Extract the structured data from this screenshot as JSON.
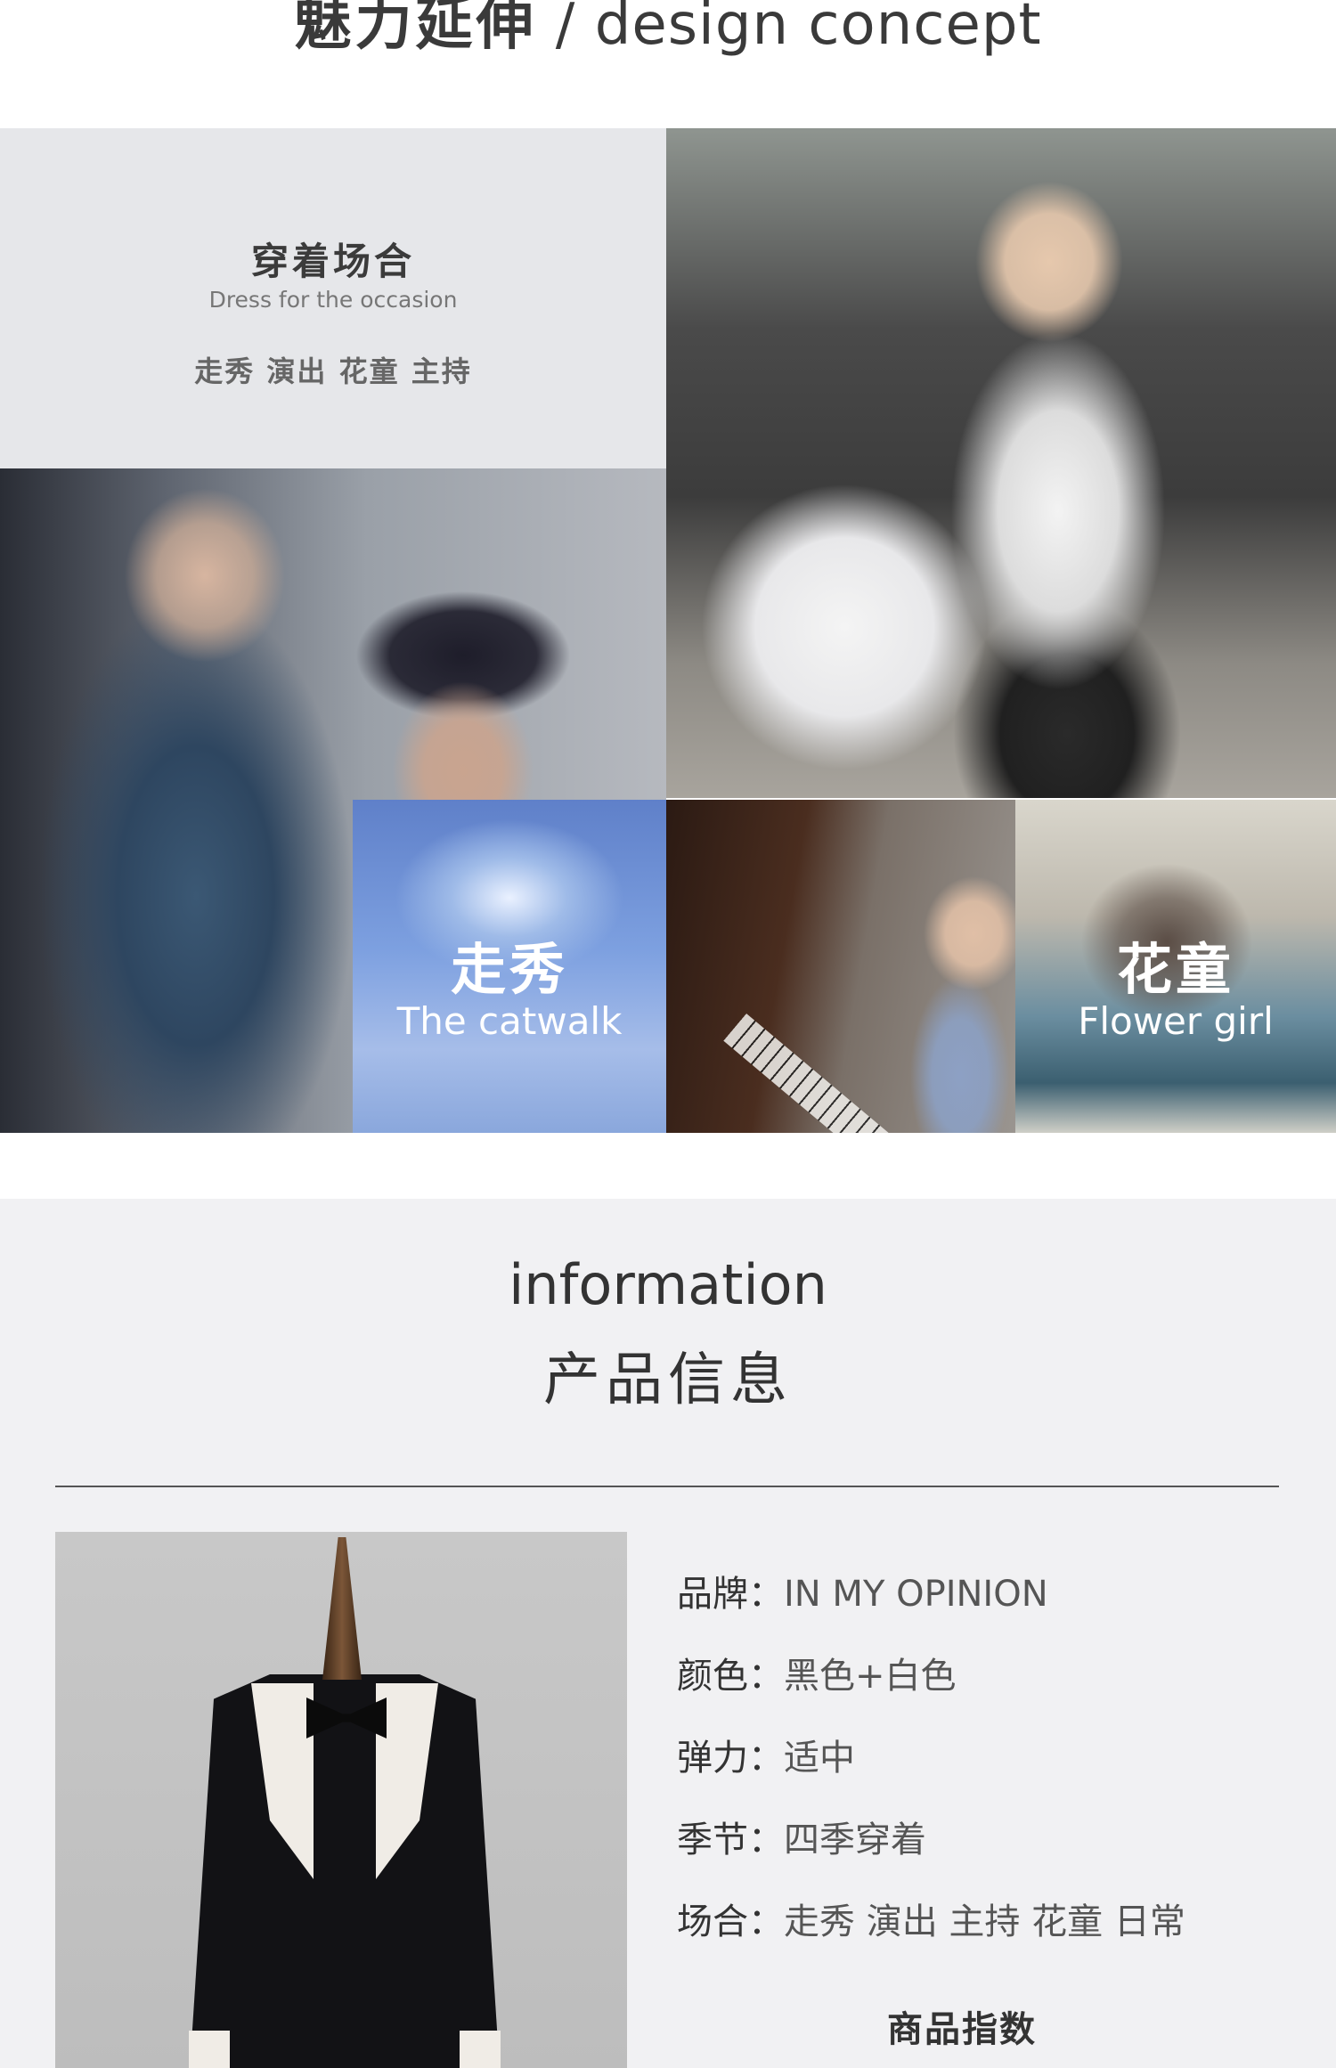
{
  "header": {
    "title_cn": "魅力延伸",
    "title_sep": " / ",
    "title_en": "design concept"
  },
  "occasion": {
    "title": "穿着场合",
    "subtitle": "Dress for the occasion",
    "keywords": "走秀 演出 花童 主持"
  },
  "tiles": {
    "catwalk": {
      "cn": "走秀",
      "en": "The catwalk"
    },
    "flower": {
      "cn": "花童",
      "en": "Flower girl"
    }
  },
  "info": {
    "title_en": "information",
    "title_cn": "产品信息",
    "specs": [
      {
        "label": "品牌：",
        "value": "IN MY OPINION"
      },
      {
        "label": "颜色：",
        "value": "黑色+白色"
      },
      {
        "label": "弹力：",
        "value": "适中"
      },
      {
        "label": "季节：",
        "value": "四季穿着"
      },
      {
        "label": "场合：",
        "value": "走秀 演出 主持 花童 日常"
      }
    ],
    "index_title": "商品指数"
  },
  "colors": {
    "occasion_bg": "#e6e7ea",
    "info_bg": "#f1f1f3",
    "text_dark": "#333333"
  }
}
